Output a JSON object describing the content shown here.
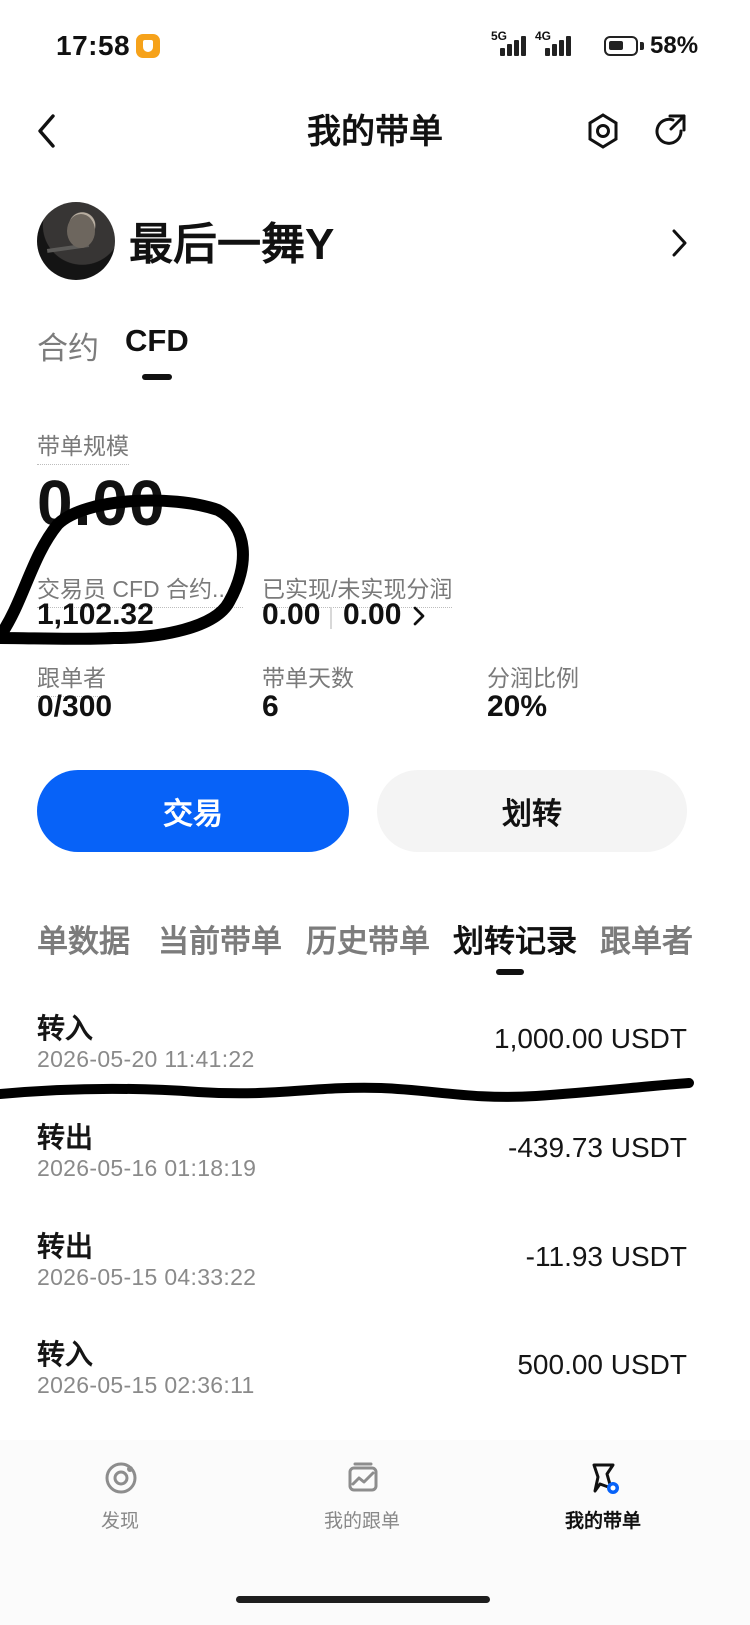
{
  "status_bar": {
    "time": "17:58",
    "network_primary": "5G",
    "network_secondary": "4G",
    "battery": "58%",
    "icons": [
      "app-shield-icon",
      "signal-5g-icon",
      "signal-4g-icon",
      "battery-icon"
    ]
  },
  "header": {
    "title": "我的带单",
    "back_icon": "back-chevron-icon",
    "settings_icon": "settings-icon",
    "share_icon": "share-icon"
  },
  "profile": {
    "name": "最后一舞Y",
    "avatar_icon": "avatar",
    "chevron_icon": "chevron-right-icon"
  },
  "segment_tabs": [
    {
      "label": "合约",
      "active": false
    },
    {
      "label": "CFD",
      "active": true
    }
  ],
  "stats": {
    "scale_label": "带单规模",
    "scale_value": "0.00",
    "trader_contract_label": "交易员 CFD 合约...",
    "trader_contract_value": "1,102.32",
    "profit_label": "已实现/未实现分润",
    "realized_value": "0.00",
    "unrealized_value": "0.00",
    "followers_label": "跟单者",
    "followers_value": "0/300",
    "days_label": "带单天数",
    "days_value": "6",
    "ratio_label": "分润比例",
    "ratio_value": "20%"
  },
  "actions": {
    "trade_label": "交易",
    "transfer_label": "划转"
  },
  "record_tabs": [
    {
      "label": "单数据",
      "active": false
    },
    {
      "label": "当前带单",
      "active": false
    },
    {
      "label": "历史带单",
      "active": false
    },
    {
      "label": "划转记录",
      "active": true
    },
    {
      "label": "跟单者",
      "active": false
    }
  ],
  "records": [
    {
      "type": "转入",
      "date": "2026-05-20 11:41:22",
      "amount": "1,000.00 USDT"
    },
    {
      "type": "转出",
      "date": "2026-05-16 01:18:19",
      "amount": "-439.73 USDT"
    },
    {
      "type": "转出",
      "date": "2026-05-15 04:33:22",
      "amount": "-11.93 USDT"
    },
    {
      "type": "转入",
      "date": "2026-05-15 02:36:11",
      "amount": "500.00 USDT"
    }
  ],
  "bottom_nav": [
    {
      "label": "发现",
      "icon": "discover-icon",
      "active": false
    },
    {
      "label": "我的跟单",
      "icon": "copy-orders-icon",
      "active": false
    },
    {
      "label": "我的带单",
      "icon": "lead-orders-icon",
      "active": true
    }
  ],
  "colors": {
    "primary": "#0762f8",
    "secondary_button": "#f4f4f4",
    "text_primary": "#111111",
    "text_secondary": "#7a7a7a",
    "annotation": "#000000"
  }
}
